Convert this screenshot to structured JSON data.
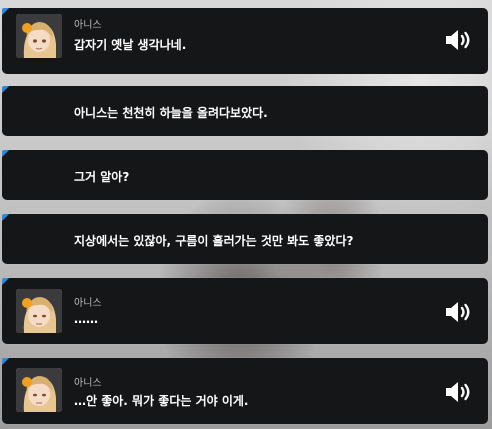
{
  "messages": [
    {
      "speaker": "아니스",
      "text": "갑자기 옛날 생각나네.",
      "has_avatar": true,
      "has_voice": true
    },
    {
      "speaker": "",
      "text": "아니스는 천천히 하늘을 올려다보았다.",
      "has_avatar": false,
      "has_voice": false
    },
    {
      "speaker": "",
      "text": "그거 알아?",
      "has_avatar": false,
      "has_voice": false
    },
    {
      "speaker": "",
      "text": "지상에서는 있잖아, 구름이 흘러가는 것만 봐도 좋았다?",
      "has_avatar": false,
      "has_voice": false
    },
    {
      "speaker": "아니스",
      "text": "……",
      "has_avatar": true,
      "has_voice": true
    },
    {
      "speaker": "아니스",
      "text": "…안 좋아. 뭐가 좋다는 거야 이게.",
      "has_avatar": true,
      "has_voice": true
    }
  ],
  "icons": {
    "voice": "speaker-volume-icon",
    "avatar": "character-portrait"
  },
  "colors": {
    "bubble": "#151618",
    "accent": "#2a8be0",
    "text": "#ffffff",
    "speaker": "#b9bbc0"
  }
}
